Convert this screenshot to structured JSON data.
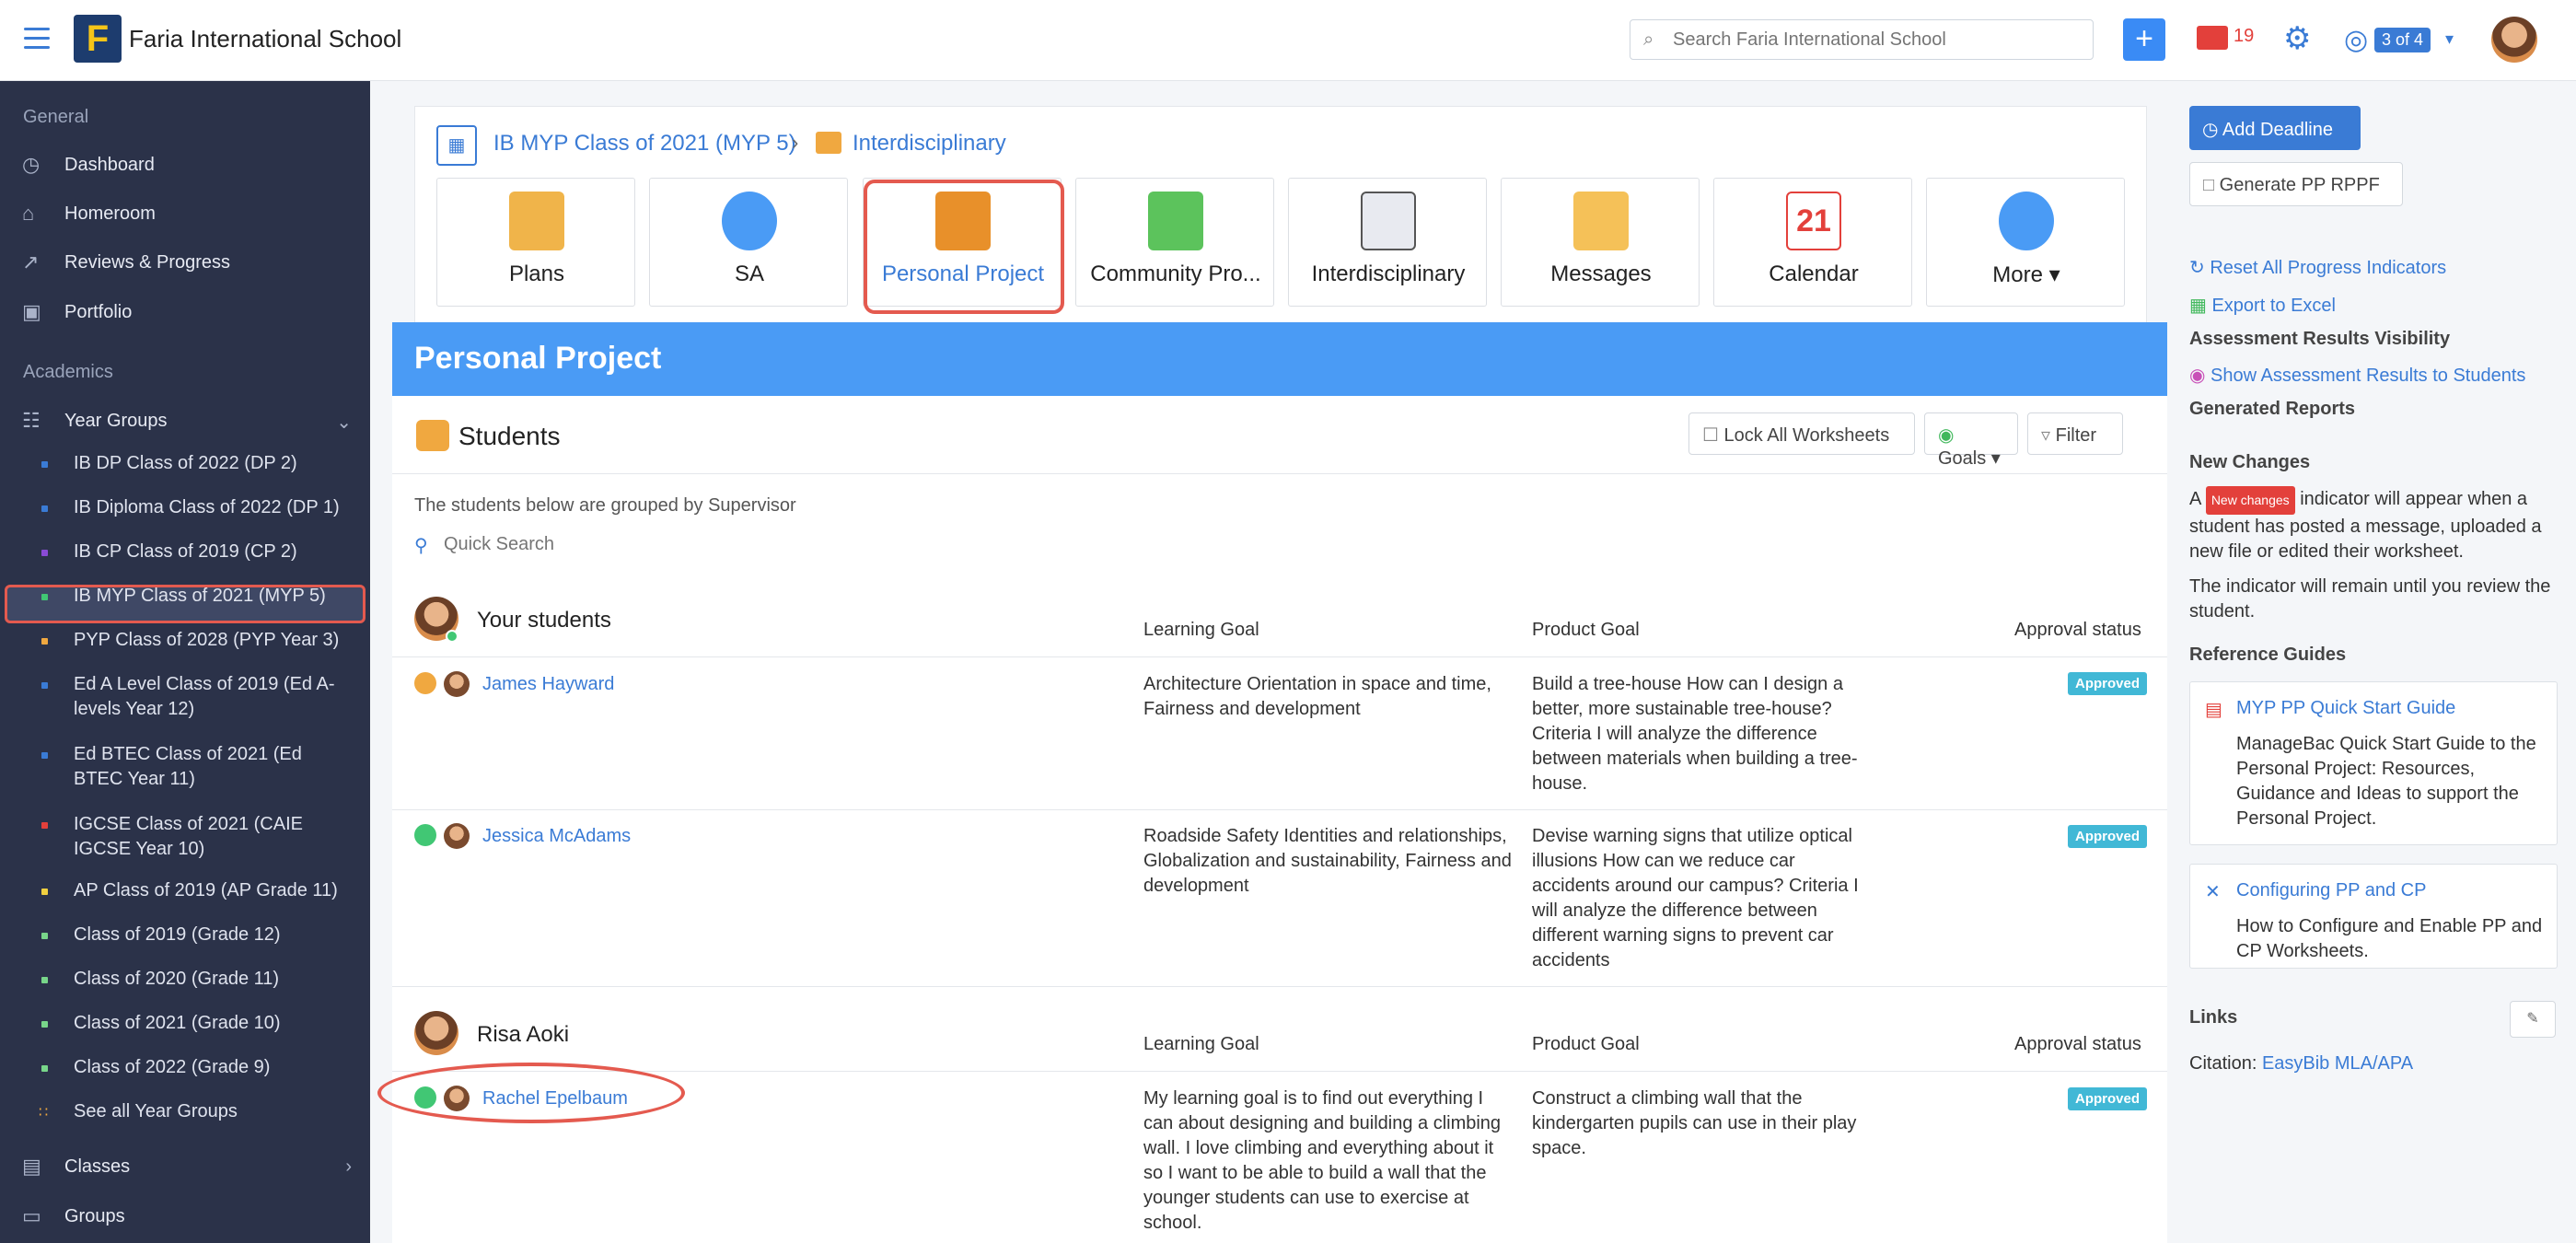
{
  "header": {
    "school_name": "Faria International School",
    "logo_letter": "F",
    "search_placeholder": "Search Faria International School",
    "mail_count": "19",
    "page_indicator": "3 of 4"
  },
  "sidebar": {
    "general_heading": "General",
    "general_items": [
      "Dashboard",
      "Homeroom",
      "Reviews & Progress",
      "Portfolio"
    ],
    "academics_heading": "Academics",
    "year_groups_label": "Year Groups",
    "year_groups": [
      {
        "label": "IB DP Class of 2022 (DP 2)",
        "color": "#3a7bd5"
      },
      {
        "label": "IB Diploma Class of 2022 (DP 1)",
        "color": "#3a7bd5"
      },
      {
        "label": "IB CP Class of 2019 (CP 2)",
        "color": "#8a4bd6"
      },
      {
        "label": "IB MYP Class of 2021 (MYP 5)",
        "color": "#41c774"
      },
      {
        "label": "PYP Class of 2028 (PYP Year 3)",
        "color": "#f0a840"
      },
      {
        "label": "Ed A Level Class of 2019 (Ed A-levels Year 12)",
        "color": "#3a7bd5"
      },
      {
        "label": "Ed BTEC Class of 2021 (Ed BTEC Year 11)",
        "color": "#3a7bd5"
      },
      {
        "label": "IGCSE Class of 2021 (CAIE IGCSE Year 10)",
        "color": "#e3403b"
      },
      {
        "label": "AP Class of 2019 (AP Grade 11)",
        "color": "#f0d040"
      },
      {
        "label": "Class of 2019 (Grade 12)",
        "color": "#78d68a"
      },
      {
        "label": "Class of 2020 (Grade 11)",
        "color": "#78d68a"
      },
      {
        "label": "Class of 2021 (Grade 10)",
        "color": "#78d68a"
      },
      {
        "label": "Class of 2022 (Grade 9)",
        "color": "#78d68a"
      }
    ],
    "see_all": "See all Year Groups",
    "classes_label": "Classes",
    "groups_label": "Groups"
  },
  "breadcrumb": {
    "parent": "IB MYP Class of 2021 (MYP 5)",
    "current": "Interdisciplinary"
  },
  "tiles": [
    "Plans",
    "SA",
    "Personal Project",
    "Community Pro...",
    "Interdisciplinary",
    "Messages",
    "Calendar",
    "More ▾"
  ],
  "page_title": "Personal Project",
  "students": {
    "title": "Students",
    "lock_btn": "Lock All Worksheets",
    "goals_btn": "Goals ▾",
    "filter_btn": "Filter",
    "group_note": "The students below are grouped by Supervisor",
    "quick_search_placeholder": "Quick Search",
    "col_learning": "Learning Goal",
    "col_product": "Product Goal",
    "col_approval": "Approval status",
    "groups": [
      {
        "supervisor": "Your students",
        "rows": [
          {
            "name": "James Hayward",
            "learning": "Architecture Orientation in space and time, Fairness and development",
            "product": "Build a tree-house How can I design a better, more sustainable tree-house? Criteria I will analyze the difference between materials when building a tree-house.",
            "status": "Approved"
          },
          {
            "name": "Jessica McAdams",
            "learning": "Roadside Safety Identities and relationships, Globalization and sustainability, Fairness and development",
            "product": "Devise warning signs that utilize optical illusions How can we reduce car accidents around our campus? Criteria I will analyze the difference between different warning signs to prevent car accidents",
            "status": "Approved"
          }
        ]
      },
      {
        "supervisor": "Risa Aoki",
        "rows": [
          {
            "name": "Rachel Epelbaum",
            "learning": "My learning goal is to find out everything I can about designing and building a climbing wall. I love climbing and everything about it so I want to be able to build a wall that the younger students can use to exercise at school.",
            "product": "Construct a climbing wall that the kindergarten pupils can use in their play space.",
            "status": "Approved"
          }
        ]
      }
    ]
  },
  "right_panel": {
    "add_deadline": "Add Deadline",
    "generate": "Generate PP RPPF",
    "reset": "Reset All Progress Indicators",
    "export": "Export to Excel",
    "assess_heading": "Assessment Results Visibility",
    "show_assess": "Show Assessment Results to Students",
    "reports_heading": "Generated Reports",
    "new_changes_heading": "New Changes",
    "new_changes_a": "A",
    "new_changes_badge": "New changes",
    "new_changes_text": "indicator will appear when a student has posted a message, uploaded a new file or edited their worksheet.",
    "indicator_text": "The indicator will remain until you review the student.",
    "ref_heading": "Reference Guides",
    "ref1_title": "MYP PP Quick Start Guide",
    "ref1_desc": "ManageBac Quick Start Guide to the Personal Project: Resources, Guidance and Ideas to support the Personal Project.",
    "ref2_title": "Configuring PP and CP",
    "ref2_desc": "How to Configure and Enable PP and CP Worksheets.",
    "links_heading": "Links",
    "citation_label": "Citation:",
    "citation_link": "EasyBib MLA/APA"
  }
}
